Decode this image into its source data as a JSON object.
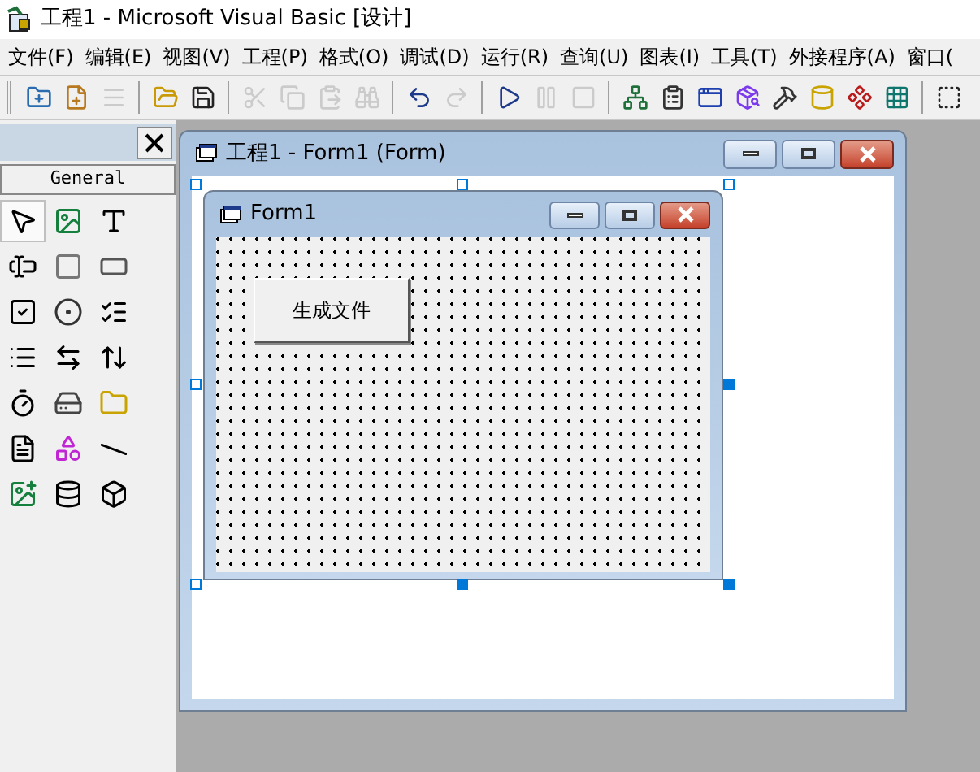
{
  "window": {
    "title": "工程1 - Microsoft Visual Basic [设计]"
  },
  "menu": [
    "文件(F)",
    "编辑(E)",
    "视图(V)",
    "工程(P)",
    "格式(O)",
    "调试(D)",
    "运行(R)",
    "查询(U)",
    "图表(I)",
    "工具(T)",
    "外接程序(A)",
    "窗口("
  ],
  "toolbar": [
    {
      "kind": "add-project",
      "disabled": false
    },
    {
      "kind": "add-form",
      "disabled": false
    },
    {
      "kind": "menu-editor",
      "disabled": true
    },
    {
      "kind": "open",
      "disabled": false
    },
    {
      "kind": "save",
      "disabled": false
    },
    {
      "kind": "cut",
      "disabled": true
    },
    {
      "kind": "copy",
      "disabled": true
    },
    {
      "kind": "paste",
      "disabled": true
    },
    {
      "kind": "find",
      "disabled": true
    },
    {
      "kind": "undo",
      "disabled": false
    },
    {
      "kind": "redo",
      "disabled": true
    },
    {
      "kind": "start",
      "disabled": false
    },
    {
      "kind": "break",
      "disabled": true
    },
    {
      "kind": "end",
      "disabled": true
    },
    {
      "kind": "project-explorer",
      "disabled": false
    },
    {
      "kind": "properties",
      "disabled": false
    },
    {
      "kind": "form-layout",
      "disabled": false
    },
    {
      "kind": "object-browser",
      "disabled": false
    },
    {
      "kind": "toolbox",
      "disabled": false
    },
    {
      "kind": "data-view",
      "disabled": false
    },
    {
      "kind": "visual-component",
      "disabled": false
    },
    {
      "kind": "component",
      "disabled": false
    },
    {
      "kind": "select",
      "disabled": false
    }
  ],
  "toolbox": {
    "tab": "General",
    "tools": [
      {
        "kind": "pointer",
        "selected": true
      },
      {
        "kind": "picture",
        "selected": false
      },
      {
        "kind": "label",
        "selected": false
      },
      {
        "kind": "textbox",
        "selected": false
      },
      {
        "kind": "frame",
        "selected": false
      },
      {
        "kind": "command",
        "selected": false
      },
      {
        "kind": "checkbox",
        "selected": false
      },
      {
        "kind": "option",
        "selected": false
      },
      {
        "kind": "combo",
        "selected": false
      },
      {
        "kind": "list",
        "selected": false
      },
      {
        "kind": "hscroll",
        "selected": false
      },
      {
        "kind": "vscroll",
        "selected": false
      },
      {
        "kind": "timer",
        "selected": false
      },
      {
        "kind": "drive",
        "selected": false
      },
      {
        "kind": "dir",
        "selected": false
      },
      {
        "kind": "file",
        "selected": false
      },
      {
        "kind": "shape",
        "selected": false
      },
      {
        "kind": "line",
        "selected": false
      },
      {
        "kind": "image",
        "selected": false
      },
      {
        "kind": "data",
        "selected": false
      },
      {
        "kind": "ole",
        "selected": false
      }
    ]
  },
  "designer": {
    "title": "工程1 - Form1 (Form)",
    "form": {
      "title": "Form1",
      "button": "生成文件"
    }
  }
}
